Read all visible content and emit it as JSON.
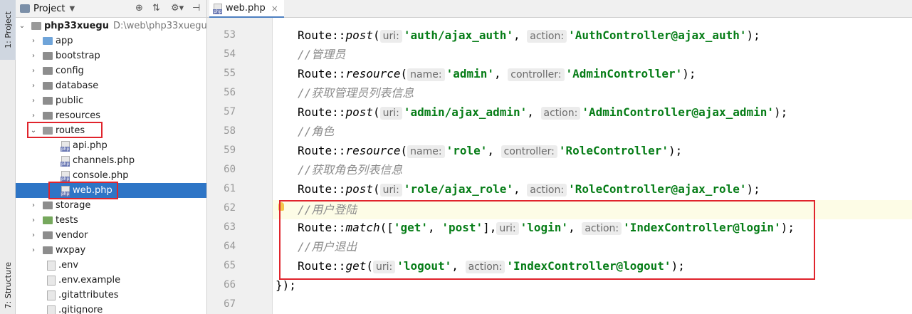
{
  "sidebar": {
    "project_tab": "1: Project",
    "structure_tab": "7: Structure"
  },
  "project_panel": {
    "title": "Project",
    "root": {
      "name": "php33xuegu",
      "path": "D:\\web\\php33xuegu"
    },
    "items": [
      {
        "label": "app"
      },
      {
        "label": "bootstrap"
      },
      {
        "label": "config"
      },
      {
        "label": "database"
      },
      {
        "label": "public"
      },
      {
        "label": "resources"
      },
      {
        "label": "routes"
      },
      {
        "label": "api.php"
      },
      {
        "label": "channels.php"
      },
      {
        "label": "console.php"
      },
      {
        "label": "web.php"
      },
      {
        "label": "storage"
      },
      {
        "label": "tests"
      },
      {
        "label": "vendor"
      },
      {
        "label": "wxpay"
      },
      {
        "label": ".env"
      },
      {
        "label": ".env.example"
      },
      {
        "label": ".gitattributes"
      },
      {
        "label": ".gitignore"
      }
    ]
  },
  "editor": {
    "tab_label": "web.php",
    "line_numbers": [
      "53",
      "54",
      "55",
      "56",
      "57",
      "58",
      "59",
      "60",
      "61",
      "62",
      "63",
      "64",
      "65",
      "66",
      "67"
    ],
    "lines": [
      {
        "route": "Route::",
        "method": "post",
        "open": "(",
        "hint1": "uri:",
        "str1": "'auth/ajax_auth'",
        "sep": ", ",
        "hint2": "action:",
        "str2": "'AuthController@ajax_auth'",
        "end": ");"
      },
      {
        "comment": "//管理员"
      },
      {
        "route": "Route::",
        "method": "resource",
        "open": "(",
        "hint1": "name:",
        "str1": "'admin'",
        "sep": ", ",
        "hint2": "controller:",
        "str2": "'AdminController'",
        "end": ");"
      },
      {
        "comment": "//获取管理员列表信息"
      },
      {
        "route": "Route::",
        "method": "post",
        "open": "(",
        "hint1": "uri:",
        "str1": "'admin/ajax_admin'",
        "sep": ", ",
        "hint2": "action:",
        "str2": "'AdminController@ajax_admin'",
        "end": ");"
      },
      {
        "comment": "//角色"
      },
      {
        "route": "Route::",
        "method": "resource",
        "open": "(",
        "hint1": "name:",
        "str1": "'role'",
        "sep": ", ",
        "hint2": "controller:",
        "str2": "'RoleController'",
        "end": ");"
      },
      {
        "comment": "//获取角色列表信息"
      },
      {
        "route": "Route::",
        "method": "post",
        "open": "(",
        "hint1": "uri:",
        "str1": "'role/ajax_role'",
        "sep": ", ",
        "hint2": "action:",
        "str2": "'RoleController@ajax_role'",
        "end": ");"
      },
      {
        "comment": "//用户登陆"
      },
      {
        "route": "Route::",
        "method": "match",
        "open": "([",
        "get": "'get'",
        "comma": ", ",
        "postv": "'post'",
        "close": "],",
        "hint1": "uri:",
        "str1": "'login'",
        "sep": ", ",
        "hint2": "action:",
        "str2": "'IndexController@login'",
        "end": ");"
      },
      {
        "comment": "//用户退出"
      },
      {
        "route": "Route::",
        "method": "get",
        "open": "(",
        "hint1": "uri:",
        "str1": "'logout'",
        "sep": ", ",
        "hint2": "action:",
        "str2": "'IndexController@logout'",
        "end": ");"
      },
      {
        "closing": "});"
      }
    ]
  },
  "colors": {
    "selection": "#2e75c6",
    "highlight_box": "#e0242c",
    "string": "#067d17",
    "comment": "#8c8c8c"
  }
}
